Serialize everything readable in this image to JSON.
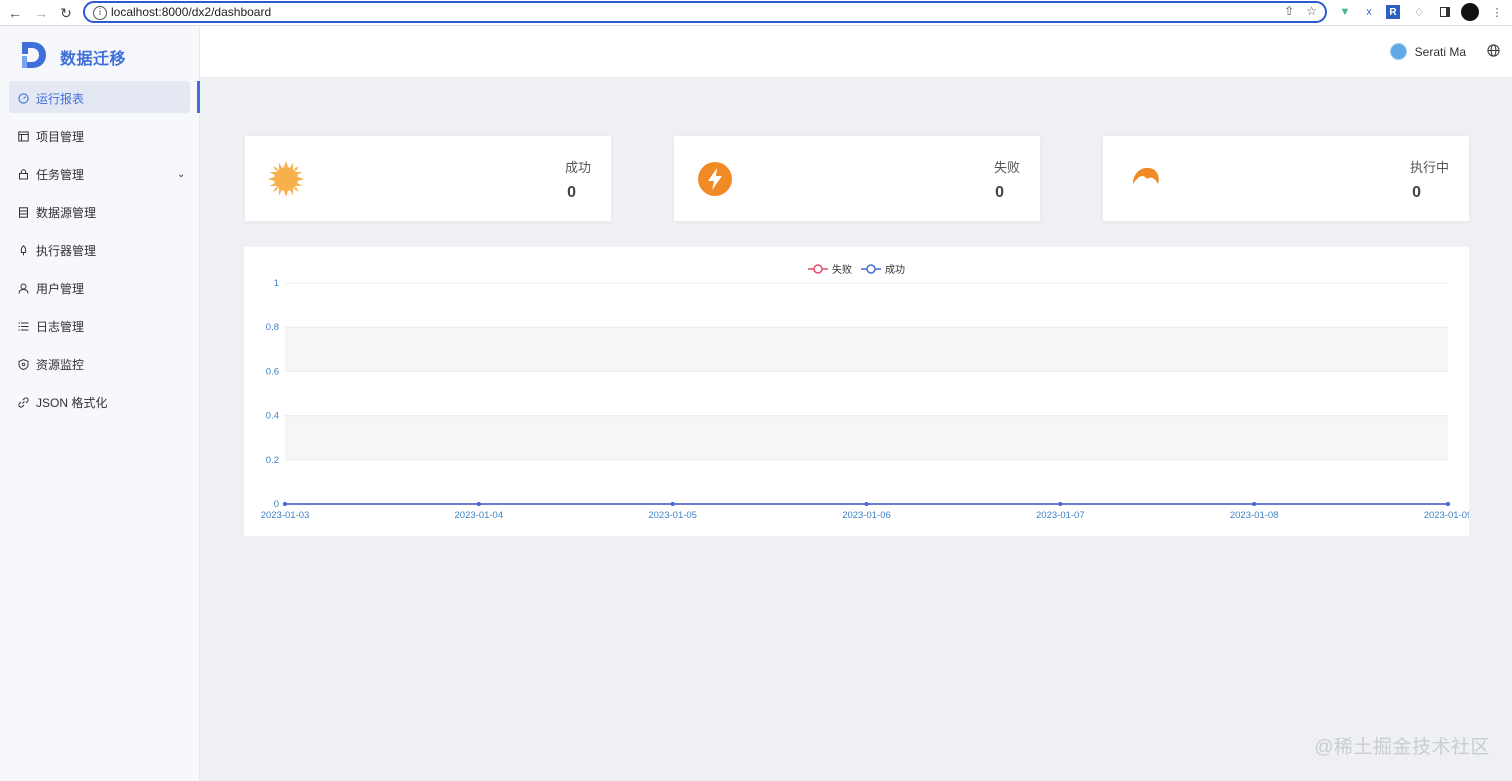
{
  "browser": {
    "url_host": "localhost",
    "url_path": ":8000/dx2/dashboard",
    "extensions": [
      "vue-devtools-icon",
      "xpath-icon",
      "r-extension-icon",
      "puzzle-icon",
      "sidepanel-icon",
      "profile-icon"
    ]
  },
  "app": {
    "title": "数据迁移",
    "brand_color": "#3f6fd9"
  },
  "sidebar": {
    "items": [
      {
        "label": "运行报表",
        "icon": "dashboard-icon",
        "active": true
      },
      {
        "label": "项目管理",
        "icon": "project-icon"
      },
      {
        "label": "任务管理",
        "icon": "lock-icon",
        "has_submenu": true
      },
      {
        "label": "数据源管理",
        "icon": "database-icon"
      },
      {
        "label": "执行器管理",
        "icon": "rocket-icon"
      },
      {
        "label": "用户管理",
        "icon": "user-icon"
      },
      {
        "label": "日志管理",
        "icon": "list-icon"
      },
      {
        "label": "资源监控",
        "icon": "shield-icon"
      },
      {
        "label": "JSON 格式化",
        "icon": "link-icon"
      }
    ]
  },
  "header": {
    "username": "Serati Ma"
  },
  "stats": [
    {
      "label": "成功",
      "value": "0",
      "icon": "sun-icon",
      "color": "#f7b04c"
    },
    {
      "label": "失败",
      "value": "0",
      "icon": "lightning-icon",
      "color": "#f08a24"
    },
    {
      "label": "执行中",
      "value": "0",
      "icon": "moon-icon",
      "color": "#f08a24"
    }
  ],
  "chart_data": {
    "type": "line",
    "x": [
      "2023-01-03",
      "2023-01-04",
      "2023-01-05",
      "2023-01-06",
      "2023-01-07",
      "2023-01-08",
      "2023-01-09"
    ],
    "y_ticks": [
      "0",
      "0.2",
      "0.4",
      "0.6",
      "0.8",
      "1"
    ],
    "ylim": [
      0,
      1
    ],
    "series": [
      {
        "name": "失败",
        "values": [
          0,
          0,
          0,
          0,
          0,
          0,
          0
        ],
        "color": "#e64a6e"
      },
      {
        "name": "成功",
        "values": [
          0,
          0,
          0,
          0,
          0,
          0,
          0
        ],
        "color": "#3f6fd9"
      }
    ],
    "legend_position": "top-center",
    "banded_grid": true
  },
  "watermark": "@稀土掘金技术社区"
}
